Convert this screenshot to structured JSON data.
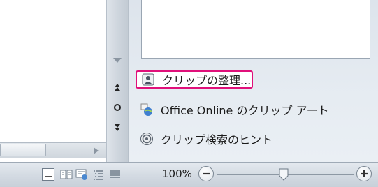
{
  "task_pane": {
    "links": [
      {
        "label": "クリップの整理...",
        "icon": "clip-organizer-icon",
        "highlighted": true
      },
      {
        "label": "Office Online のクリップ アート",
        "icon": "office-online-icon"
      },
      {
        "label": "クリップ検索のヒント",
        "icon": "help-icon"
      }
    ],
    "highlight_color": "#e0107a"
  },
  "status_bar": {
    "zoom_level": "100%",
    "zoom_fraction": 0.5,
    "view_buttons": [
      "print-layout-view",
      "full-screen-reading-view",
      "web-layout-view",
      "outline-view",
      "draft-view"
    ],
    "active_view": "print-layout-view"
  }
}
